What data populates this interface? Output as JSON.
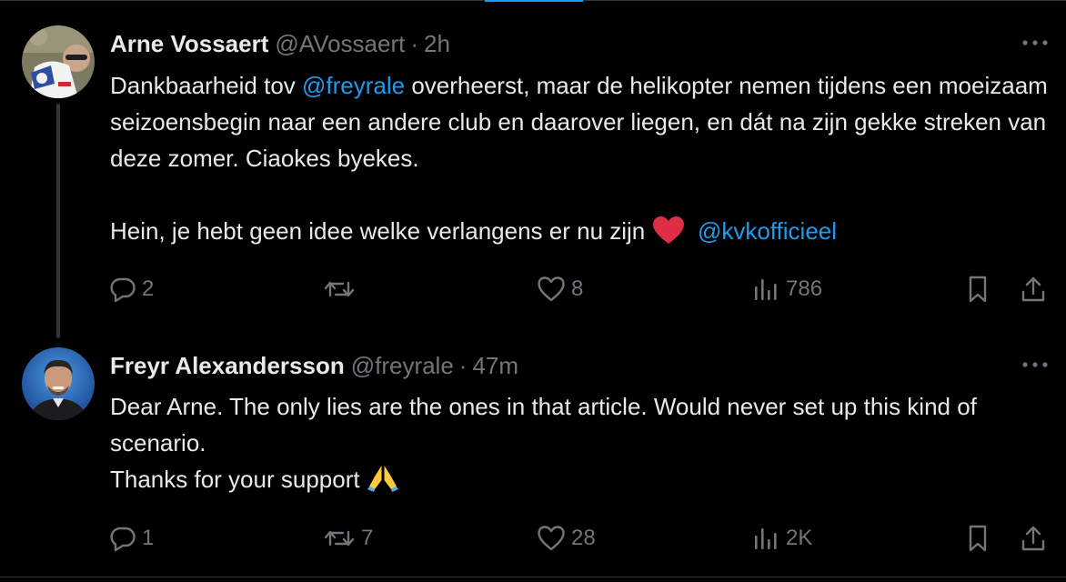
{
  "tweets": [
    {
      "author": {
        "name": "Arne Vossaert",
        "handle": "@AVossaert",
        "time": "2h"
      },
      "text": {
        "part1": "Dankbaarheid tov ",
        "mention1": "@freyrale",
        "part2": " overheerst, maar de helikopter nemen tijdens een moeizaam seizoensbegin naar een andere club en daarover liegen, en dát na zijn gekke streken van deze zomer. Ciaokes byekes.",
        "part3": "Hein, je hebt geen idee welke verlangens er nu zijn ",
        "emoji": "red-heart",
        "mention2": "@kvkofficieel"
      },
      "actions": {
        "replies": "2",
        "retweets": "",
        "likes": "8",
        "views": "786"
      }
    },
    {
      "author": {
        "name": "Freyr Alexandersson",
        "handle": "@freyrale",
        "time": "47m"
      },
      "text": {
        "line1": "Dear Arne. The only lies are the ones in that article. Would never set up this kind of scenario.",
        "line2": "Thanks for your support ",
        "emoji": "folded-hands"
      },
      "actions": {
        "replies": "1",
        "retweets": "7",
        "likes": "28",
        "views": "2K"
      }
    }
  ],
  "icons": {
    "reply": "speech-bubble-icon",
    "retweet": "retweet-arrows-icon",
    "like": "heart-outline-icon",
    "views": "bar-chart-icon",
    "bookmark": "bookmark-icon",
    "share": "upload-share-icon",
    "more": "more-dots-icon"
  },
  "colors": {
    "background": "#000000",
    "text": "#e7e9ea",
    "secondary": "#71767b",
    "link": "#1d9bf0",
    "thread_line": "#333639"
  }
}
